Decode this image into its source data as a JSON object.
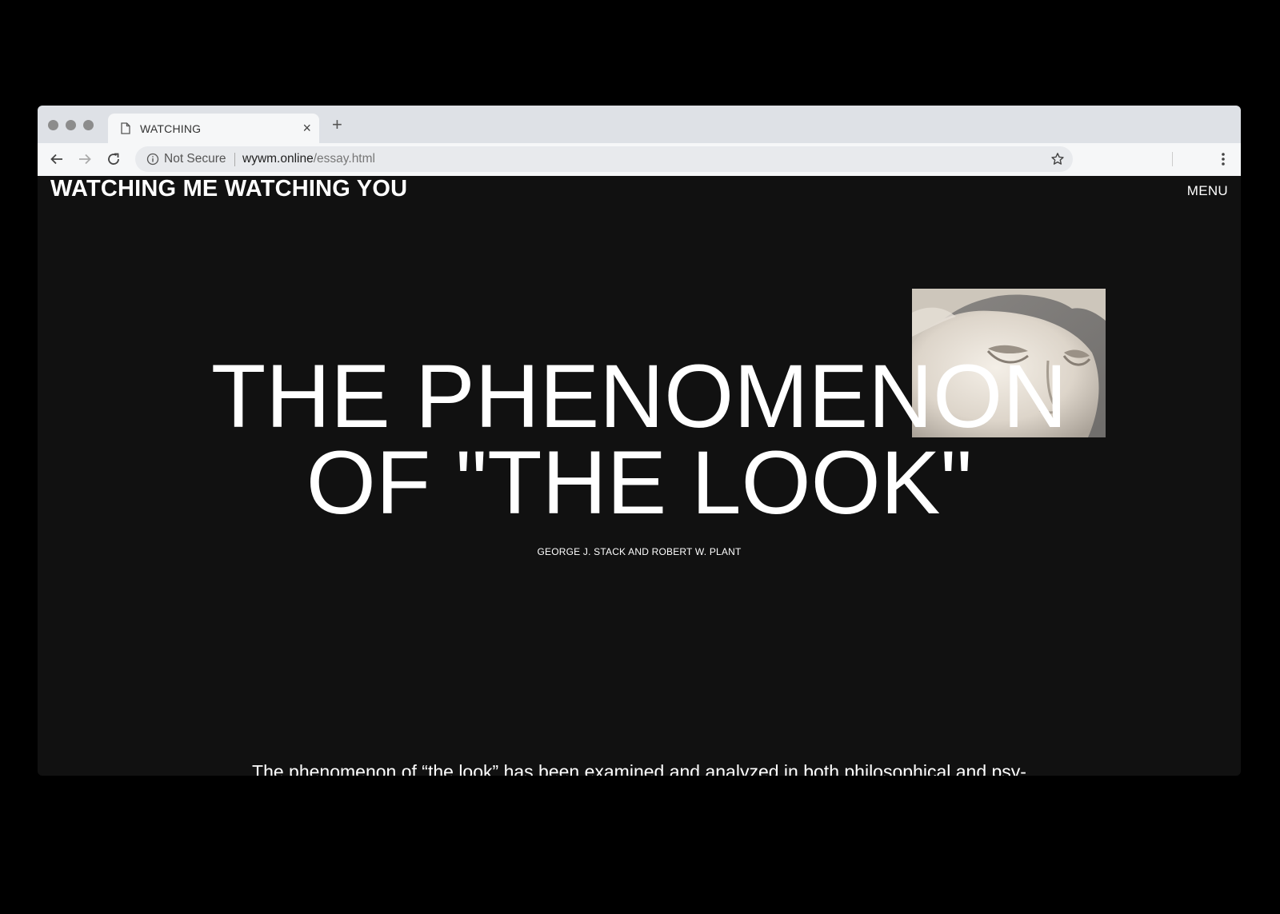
{
  "browser": {
    "tab_title": "WATCHING",
    "new_tab": "+",
    "close_tab": "×",
    "security_label": "Not Secure",
    "url_host": "wywm.online",
    "url_path": "/essay.html"
  },
  "site": {
    "title": "WATCHING ME WATCHING YOU",
    "menu_label": "MENU"
  },
  "article": {
    "headline_line1": "THE PHENOMENON",
    "headline_line2": "OF \"THE LOOK\"",
    "authors": "GEORGE J. STACK AND ROBERT W. PLANT",
    "intro_text": "The phenomenon of “the look” has been examined and analyzed in both philosophical and psy-"
  },
  "colors": {
    "page_background": "#111111",
    "text": "#ffffff",
    "tabbar": "#dee1e6",
    "toolbar": "#f6f7f8"
  },
  "icons": [
    "page-icon",
    "back-arrow-icon",
    "forward-arrow-icon",
    "reload-icon",
    "info-icon",
    "star-icon",
    "more-vert-icon"
  ]
}
